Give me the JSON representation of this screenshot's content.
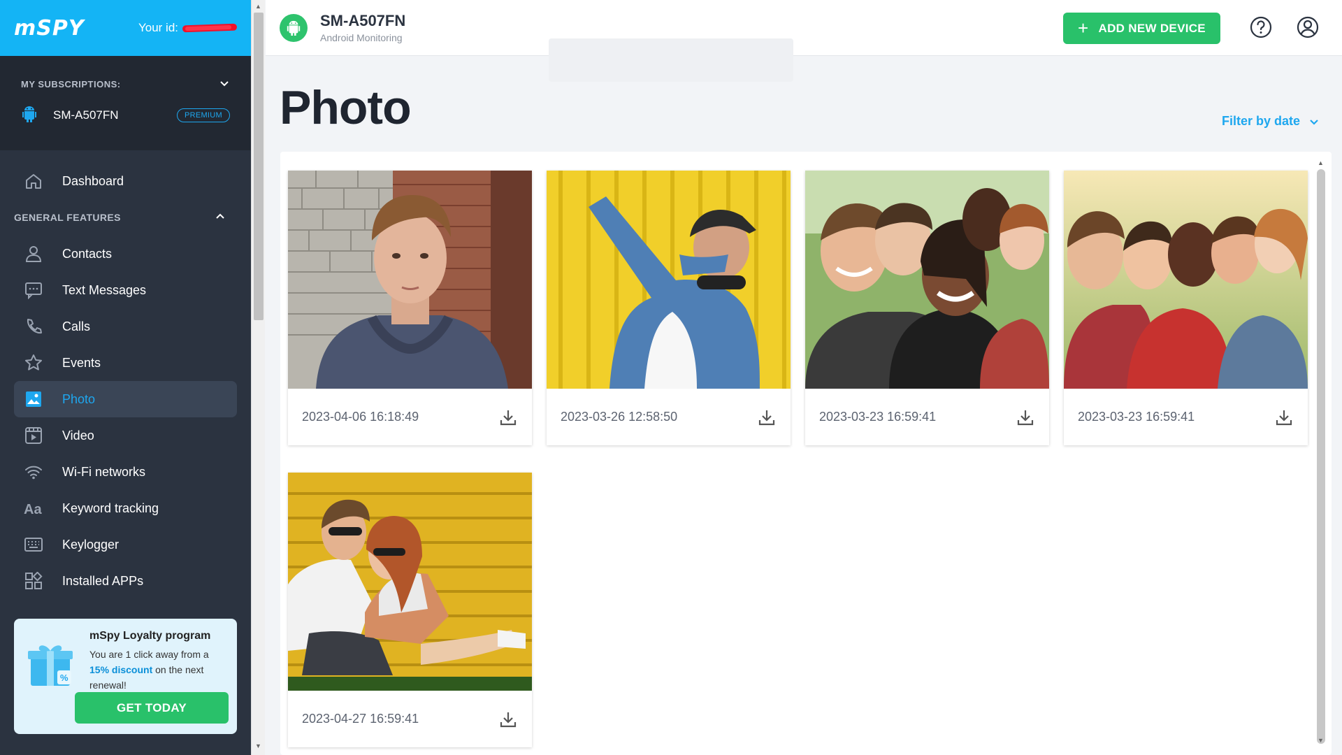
{
  "brand": {
    "logo": "mSPY",
    "user_id_label": "Your id:"
  },
  "subscriptions": {
    "label": "MY SUBSCRIPTIONS:",
    "device": "SM-A507FN",
    "plan": "PREMIUM"
  },
  "nav": {
    "dashboard": "Dashboard",
    "section_label": "GENERAL FEATURES",
    "items": [
      {
        "label": "Contacts",
        "icon": "person-icon"
      },
      {
        "label": "Text Messages",
        "icon": "message-icon"
      },
      {
        "label": "Calls",
        "icon": "phone-icon"
      },
      {
        "label": "Events",
        "icon": "star-icon"
      },
      {
        "label": "Photo",
        "icon": "image-icon",
        "active": true
      },
      {
        "label": "Video",
        "icon": "video-icon"
      },
      {
        "label": "Wi-Fi networks",
        "icon": "wifi-icon"
      },
      {
        "label": "Keyword tracking",
        "icon": "text-aa-icon"
      },
      {
        "label": "Keylogger",
        "icon": "keyboard-icon"
      },
      {
        "label": "Installed APPs",
        "icon": "apps-grid-icon"
      }
    ]
  },
  "loyalty": {
    "title": "mSpy Loyalty program",
    "text_before": "You are 1 click away from a",
    "discount": "15% discount",
    "text_after": "on the next renewal!",
    "button": "GET TODAY"
  },
  "header": {
    "device": "SM-A507FN",
    "subtitle": "Android Monitoring",
    "add_button": "ADD NEW DEVICE"
  },
  "page": {
    "title": "Photo",
    "filter_label": "Filter by date"
  },
  "photos": [
    {
      "timestamp": "2023-04-06 16:18:49"
    },
    {
      "timestamp": "2023-03-26 12:58:50"
    },
    {
      "timestamp": "2023-03-23 16:59:41"
    },
    {
      "timestamp": "2023-03-23 16:59:41"
    },
    {
      "timestamp": "2023-04-27 16:59:41"
    }
  ],
  "colors": {
    "accent": "#1ea7ef",
    "brand": "#14b4f5",
    "green": "#29c16a",
    "sidebar": "#2b3340"
  }
}
